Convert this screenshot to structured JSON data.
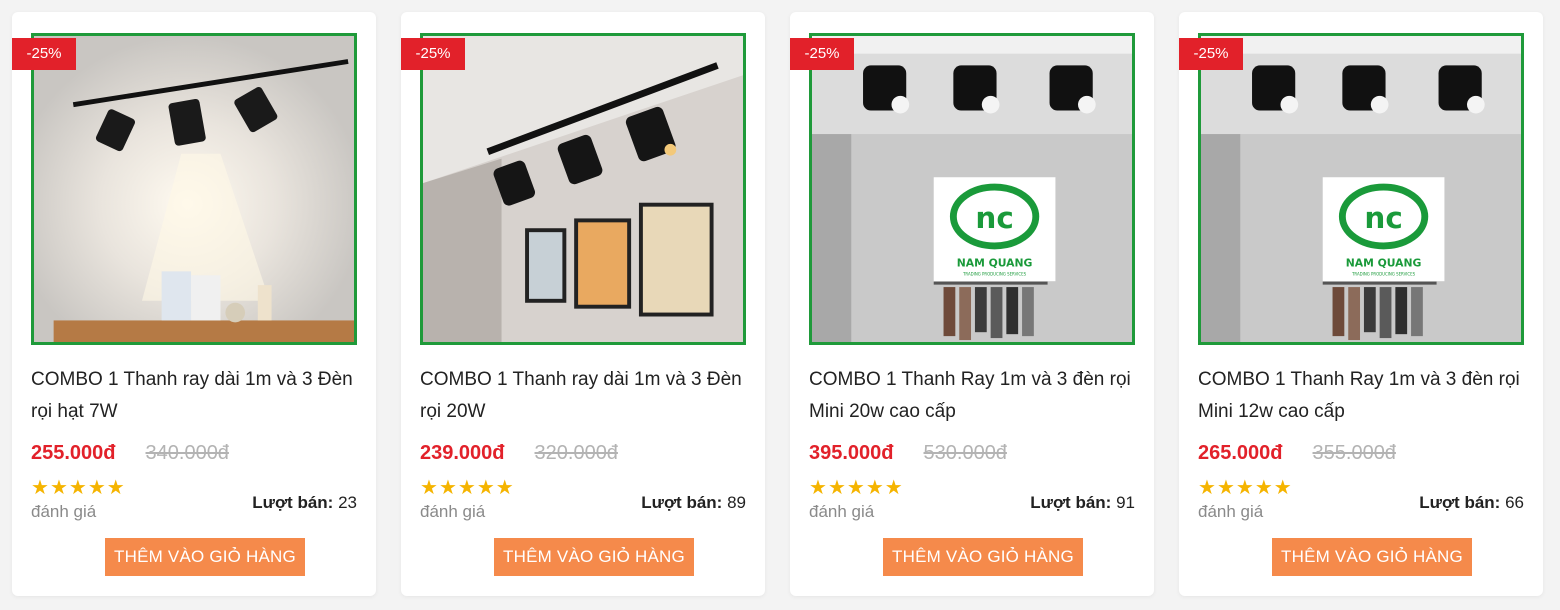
{
  "products": [
    {
      "discount": "-25%",
      "title": "COMBO 1 Thanh ray dài 1m và 3 Đèn rọi hạt 7W",
      "price": "255.000đ",
      "old_price": "340.000đ",
      "rating_stars": 5,
      "rating_label": "đánh giá",
      "sold_label": "Lượt bán:",
      "sold_count": "23",
      "cart_label": "THÊM VÀO GIỎ HÀNG"
    },
    {
      "discount": "-25%",
      "title": "COMBO 1 Thanh ray dài 1m và 3 Đèn rọi 20W",
      "price": "239.000đ",
      "old_price": "320.000đ",
      "rating_stars": 5,
      "rating_label": "đánh giá",
      "sold_label": "Lượt bán:",
      "sold_count": "89",
      "cart_label": "THÊM VÀO GIỎ HÀNG"
    },
    {
      "discount": "-25%",
      "title": "COMBO 1 Thanh Ray 1m và 3 đèn rọi Mini 20w cao cấp",
      "price": "395.000đ",
      "old_price": "530.000đ",
      "rating_stars": 5,
      "rating_label": "đánh giá",
      "sold_label": "Lượt bán:",
      "sold_count": "91",
      "cart_label": "THÊM VÀO GIỎ HÀNG",
      "logo_text": "NAM QUANG",
      "logo_subtext": "TRADING PRODUCING SERVICES"
    },
    {
      "discount": "-25%",
      "title": "COMBO 1 Thanh Ray 1m và 3 đèn rọi Mini 12w cao cấp",
      "price": "265.000đ",
      "old_price": "355.000đ",
      "rating_stars": 5,
      "rating_label": "đánh giá",
      "sold_label": "Lượt bán:",
      "sold_count": "66",
      "cart_label": "THÊM VÀO GIỎ HÀNG",
      "logo_text": "NAM QUANG",
      "logo_subtext": "TRADING PRODUCING SERVICES"
    }
  ],
  "colors": {
    "accent_red": "#e2212a",
    "button_orange": "#f58a4b",
    "image_border_green": "#1f9a3a",
    "star_yellow": "#f5b400"
  },
  "icons": [
    "star-icon"
  ]
}
